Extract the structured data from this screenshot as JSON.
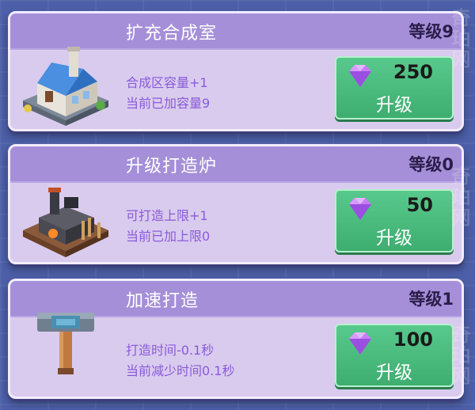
{
  "watermark": "奇珀网",
  "cards": [
    {
      "title": "扩充合成室",
      "level": "等级9",
      "line1": "合成区容量+1",
      "line2": "当前已加容量9",
      "cost": "250",
      "button_label": "升级",
      "icon": "workshop-building-icon"
    },
    {
      "title": "升级打造炉",
      "level": "等级0",
      "line1": "可打造上限+1",
      "line2": "当前已加上限0",
      "cost": "50",
      "button_label": "升级",
      "icon": "forge-furnace-icon"
    },
    {
      "title": "加速打造",
      "level": "等级1",
      "line1": "打造时间-0.1秒",
      "line2": "当前减少时间0.1秒",
      "cost": "100",
      "button_label": "升级",
      "icon": "hammer-icon"
    }
  ],
  "colors": {
    "header": "#a58fd8",
    "card": "#d9cbee",
    "button": "#4dbd7f",
    "gem": "#b56bf0",
    "description": "#8a5bd8"
  }
}
